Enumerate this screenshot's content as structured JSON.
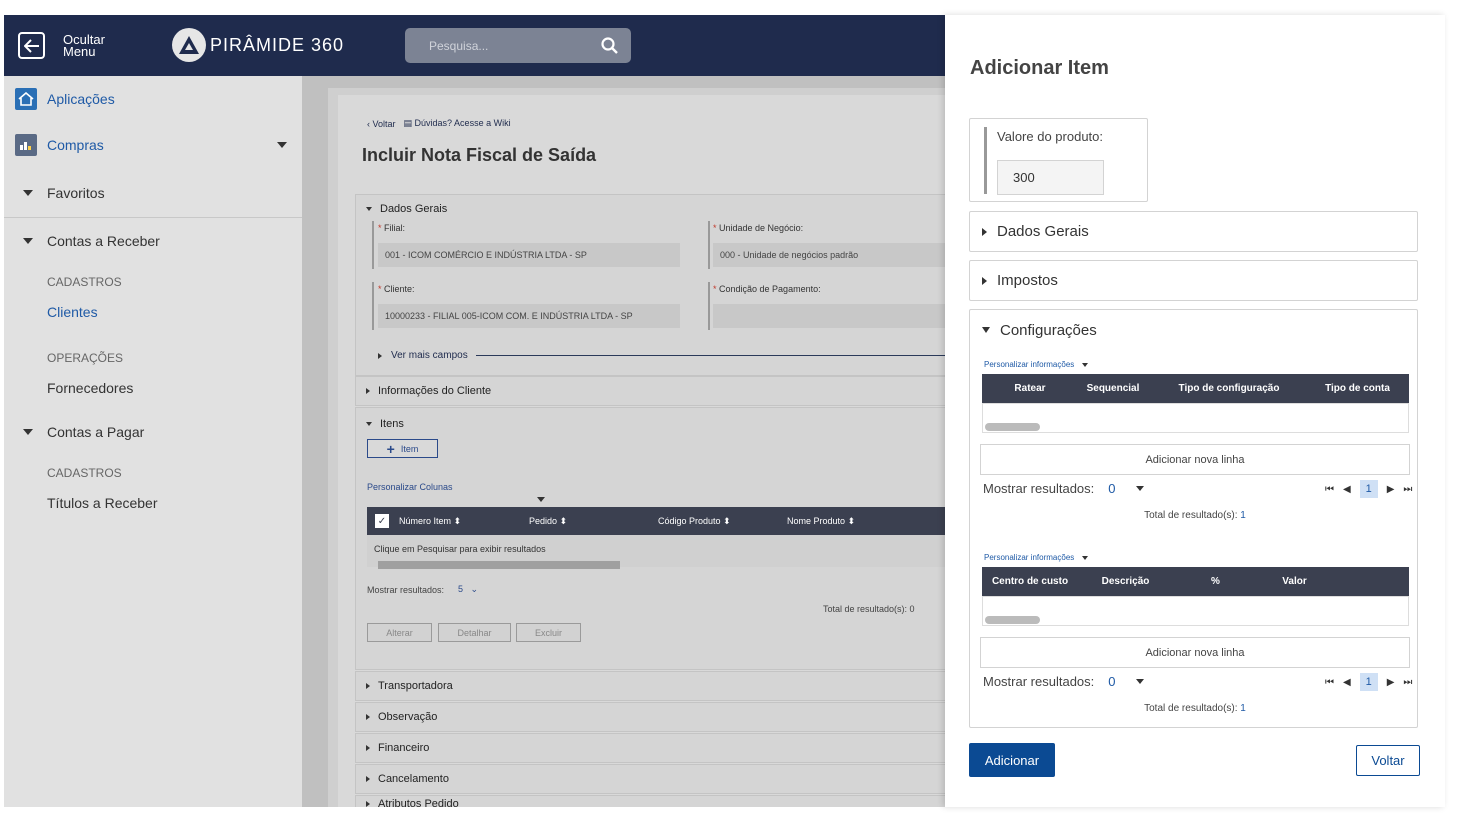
{
  "topbar": {
    "hide_menu_label": "Ocultar Menu",
    "logo_text": "PIRÂMIDE 360",
    "search_placeholder": "Pesquisa..."
  },
  "sidebar": {
    "aplicacoes": "Aplicações",
    "compras": "Compras",
    "favoritos": "Favoritos",
    "contas_receber": "Contas a Receber",
    "cadastros1": "CADASTROS",
    "clientes": "Clientes",
    "operacoes": "OPERAÇÕES",
    "fornecedores": "Fornecedores",
    "contas_pagar": "Contas a Pagar",
    "cadastros2": "CADASTROS",
    "titulos": "Títulos a Receber"
  },
  "main": {
    "back": "Voltar",
    "wiki": "Dúvidas? Acesse a Wiki",
    "title": "Incluir Nota Fiscal de Saída",
    "dados_gerais": "Dados Gerais",
    "filial_label": "Filial:",
    "filial_value": "001 - ICOM COMÉRCIO E INDÚSTRIA LTDA - SP",
    "unidade_label": "Unidade de Negócio:",
    "unidade_value": "000 - Unidade de negócios padrão",
    "cliente_label": "Cliente:",
    "cliente_value": "10000233 - FILIAL 005-ICOM COM. E INDÚSTRIA LTDA - SP",
    "condicao_label": "Condição de Pagamento:",
    "ver_mais": "Ver mais campos",
    "info_cliente": "Informações do Cliente",
    "itens": "Itens",
    "item_btn": "Item",
    "personalizar_colunas": "Personalizar Colunas",
    "col_numero": "Número Item",
    "col_pedido": "Pedido",
    "col_codigo": "Código Produto",
    "col_nome": "Nome Produto",
    "empty_msg": "Clique em Pesquisar para exibir resultados",
    "mostrar_label": "Mostrar resultados:",
    "mostrar_value": "5",
    "total_label": "Total de resultado(s): 0",
    "alterar": "Alterar",
    "detalhar": "Detalhar",
    "excluir": "Excluir",
    "transportadora": "Transportadora",
    "observacao": "Observação",
    "financeiro": "Financeiro",
    "cancelamento": "Cancelamento",
    "atributos": "Atributos Pedido"
  },
  "drawer": {
    "title": "Adicionar Item",
    "valor_label": "Valore do produto:",
    "valor_value": "300",
    "dados_gerais": "Dados Gerais",
    "impostos": "Impostos",
    "configuracoes": "Configurações",
    "personalizar": "Personalizar informações",
    "t1_cols": [
      "Ratear",
      "Sequencial",
      "Tipo de configuração",
      "Tipo de conta"
    ],
    "t2_cols": [
      "Centro de custo",
      "Descrição",
      "%",
      "Valor"
    ],
    "add_line": "Adicionar nova linha",
    "mostrar_label": "Mostrar resultados:",
    "mostrar_value": "0",
    "page": "1",
    "total_label": "Total de resultado(s):",
    "total_value": "1",
    "adicionar": "Adicionar",
    "voltar": "Voltar"
  }
}
